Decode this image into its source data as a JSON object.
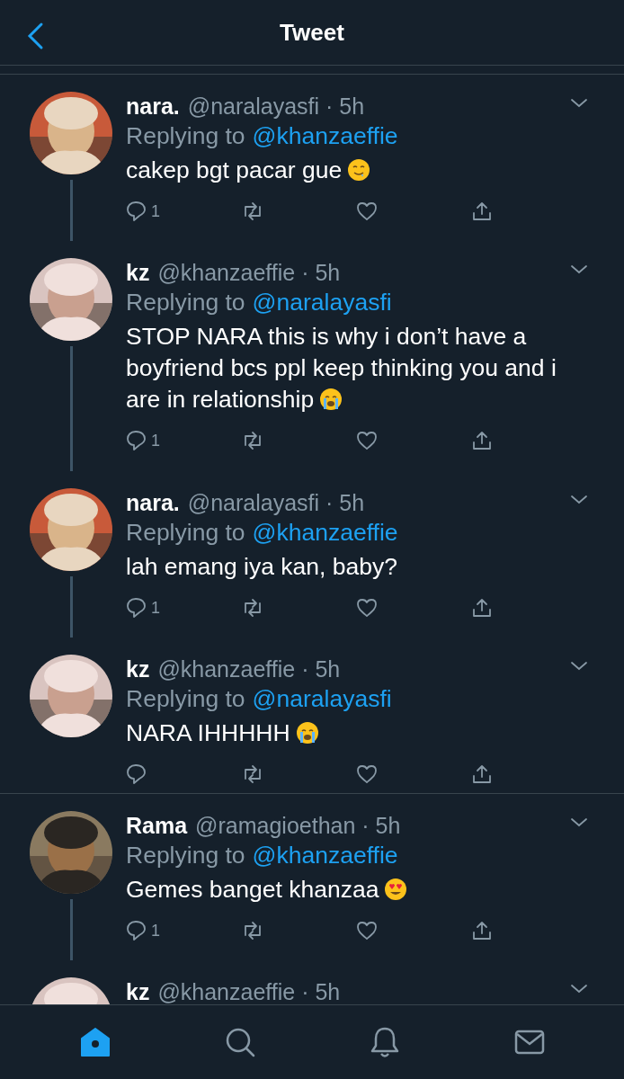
{
  "header": {
    "title": "Tweet"
  },
  "tweets": [
    {
      "name": "nara.",
      "meta": "@naralayasfi · 5h",
      "replying_label": "Replying to",
      "replying_to": "@khanzaeffie",
      "text": "cakep bgt pacar gue",
      "emoji": {
        "kind": "drool"
      },
      "replies": "1",
      "thread_line": true,
      "divider_after": false
    },
    {
      "name": "kz",
      "meta": "@khanzaeffie · 5h",
      "replying_label": "Replying to",
      "replying_to": "@naralayasfi",
      "text": "STOP NARA this is why i don’t have a boyfriend bcs ppl keep thinking you and i are in relationship",
      "emoji": {
        "kind": "crying"
      },
      "replies": "1",
      "thread_line": true,
      "divider_after": false
    },
    {
      "name": "nara.",
      "meta": "@naralayasfi · 5h",
      "replying_label": "Replying to",
      "replying_to": "@khanzaeffie",
      "text": "lah emang iya kan, baby?",
      "replies": "1",
      "thread_line": true,
      "divider_after": false
    },
    {
      "name": "kz",
      "meta": "@khanzaeffie · 5h",
      "replying_label": "Replying to",
      "replying_to": "@naralayasfi",
      "text": "NARA IHHHHH",
      "emoji": {
        "kind": "crying"
      },
      "thread_line": false,
      "divider_after": true
    },
    {
      "name": "Rama",
      "meta": "@ramagioethan · 5h",
      "replying_label": "Replying to",
      "replying_to": "@khanzaeffie",
      "text": "Gemes banget khanzaa",
      "emoji": {
        "kind": "heart-eyes"
      },
      "replies": "1",
      "thread_line": true,
      "divider_after": false
    },
    {
      "name": "kz",
      "meta": "@khanzaeffie · 5h"
    }
  ],
  "tab_bar": [
    {
      "kind": "home",
      "selected": true
    },
    {
      "kind": "search",
      "selected": false
    },
    {
      "kind": "bell",
      "selected": false
    },
    {
      "kind": "mail",
      "selected": false
    }
  ]
}
